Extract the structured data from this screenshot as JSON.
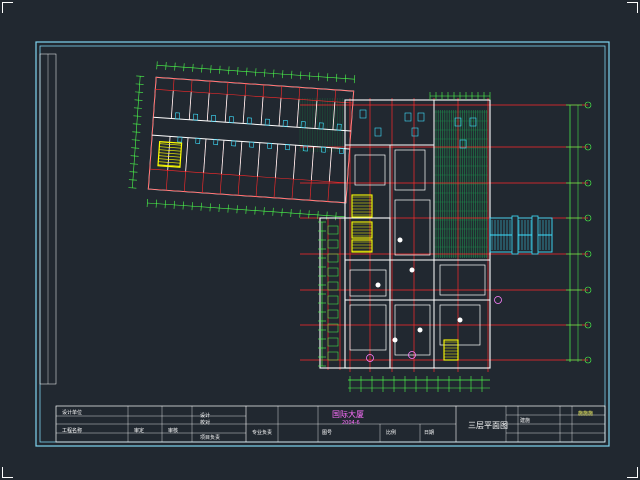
{
  "drawing": {
    "background": "#212830",
    "frame_color": "#7fd4f0",
    "wall_color": "#ffffff",
    "axis_color": "#ff2a2a",
    "dimension_color": "#4cff4c",
    "hatch_color": "#1f8a4c",
    "accent_yellow": "#ffff00",
    "stair_color": "#3ee0ff",
    "view_name": "三层平面图"
  },
  "title_block": {
    "project_title": "国际大厦",
    "project_date": "2004-6",
    "sheet_title": "三层平面图",
    "designer_label": "设计",
    "checker_label": "校对",
    "sheet_no": "施施施",
    "small_labels": [
      "设计单位",
      "工程名称",
      "审定",
      "审核",
      "项目负责",
      "专业负责",
      "图号",
      "比例",
      "日期",
      "建施"
    ]
  },
  "corner_marks": [
    "top-left",
    "top-right",
    "bottom-left",
    "bottom-right"
  ]
}
